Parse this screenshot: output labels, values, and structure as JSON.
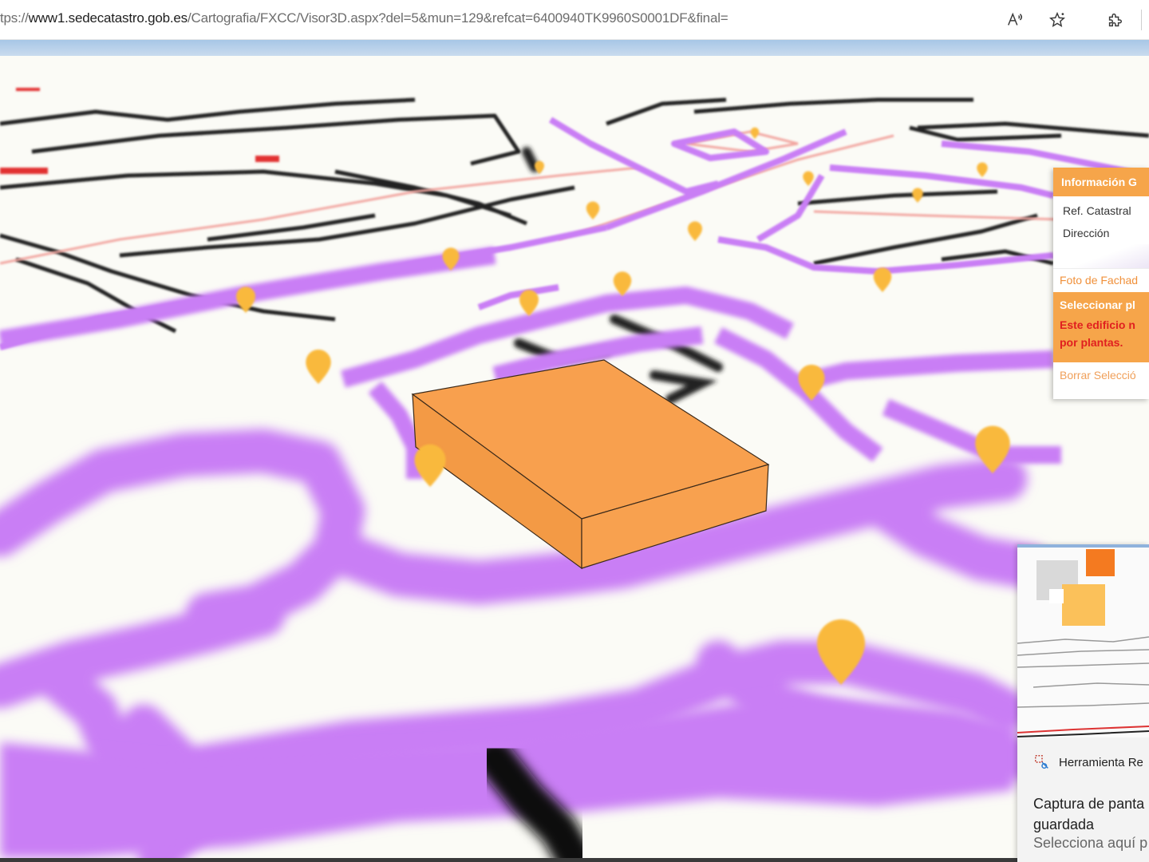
{
  "browser": {
    "url_prefix": "tps://",
    "url_host": "www1.sedecatastro.gob.es",
    "url_path": "/Cartografia/FXCC/Visor3D.aspx?del=5&mun=129&refcat=6400940TK9960S0001DF&final=",
    "icons": [
      "read-aloud-icon",
      "favorite-star-icon",
      "extensions-icon"
    ]
  },
  "info_panel": {
    "header": "Información G",
    "ref_label": "Ref. Catastral",
    "address_label": "Dirección",
    "facade_link": "Foto de Fachad",
    "select_title": "Seleccionar pl",
    "warning_line1": "Este edificio n",
    "warning_line2": "por plantas.",
    "clear_link": "Borrar Selecció",
    "accent_color": "#f6a54a",
    "warning_color": "#e02020"
  },
  "notification": {
    "app_name": "Herramienta Re",
    "title_line1": "Captura de panta",
    "title_line2": "guardada",
    "subtitle": "Selecciona aquí p"
  },
  "map": {
    "building_color": "#f8a04e",
    "marker_color": "#f9b93c",
    "boundary_color": "#c97ef5"
  }
}
